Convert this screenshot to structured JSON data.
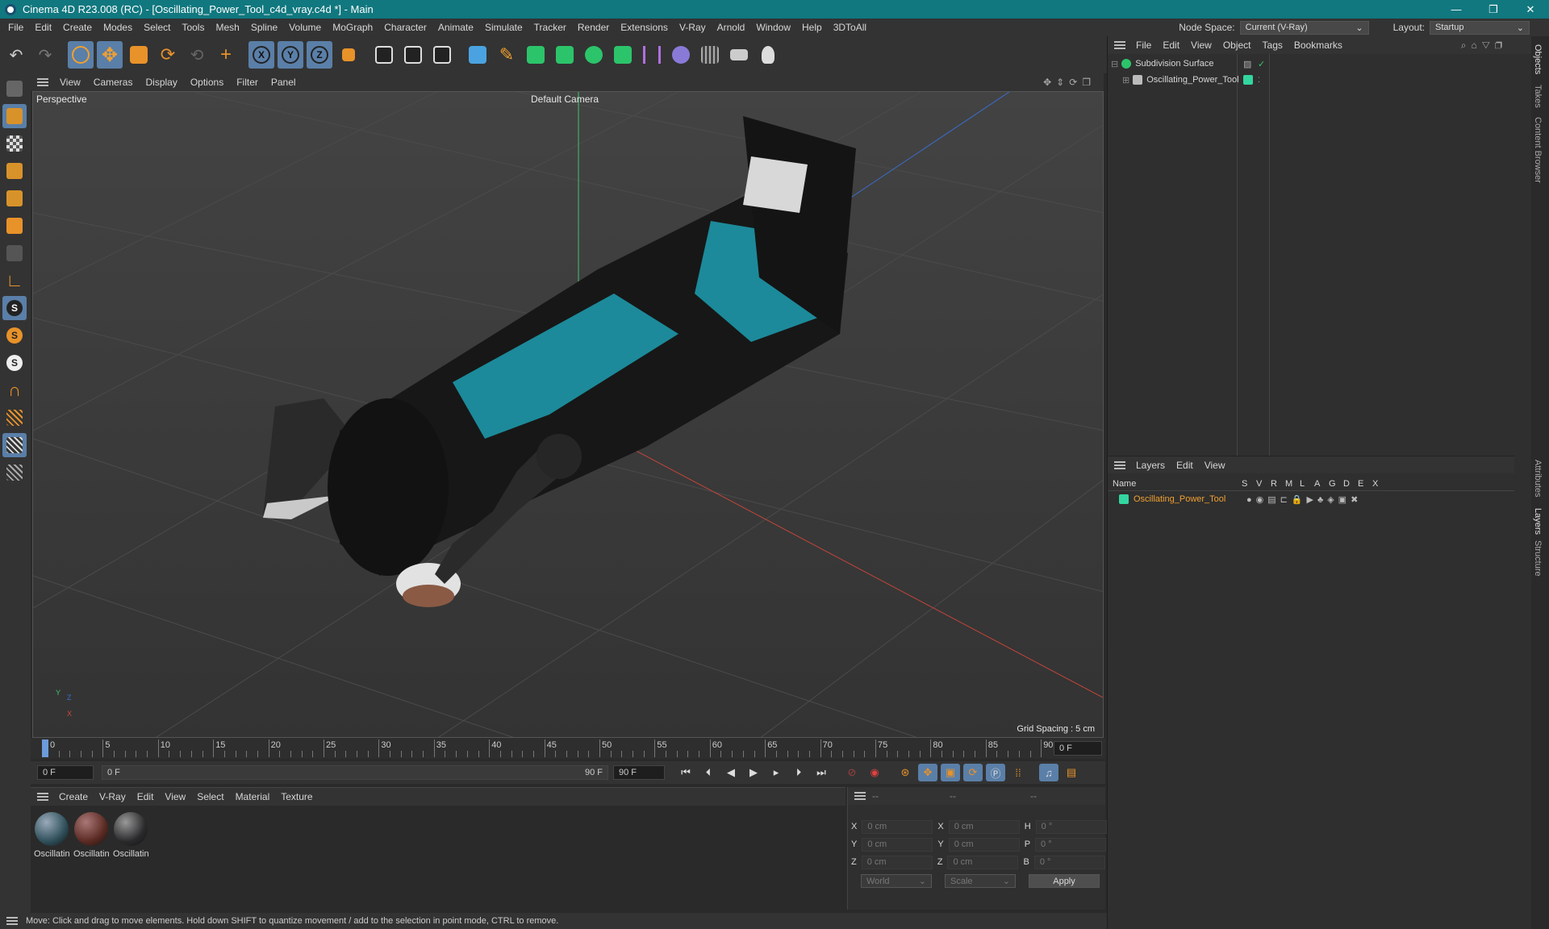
{
  "window": {
    "title": "Cinema 4D R23.008 (RC) - [Oscillating_Power_Tool_c4d_vray.c4d *] - Main",
    "buttons": [
      "—",
      "❐",
      "✕"
    ]
  },
  "menubar": {
    "items": [
      "File",
      "Edit",
      "Create",
      "Modes",
      "Select",
      "Tools",
      "Mesh",
      "Spline",
      "Volume",
      "MoGraph",
      "Character",
      "Animate",
      "Simulate",
      "Tracker",
      "Render",
      "Extensions",
      "V-Ray",
      "Arnold",
      "Window",
      "Help",
      "3DToAll"
    ],
    "node_space_label": "Node Space:",
    "node_space_value": "Current (V-Ray)",
    "layout_label": "Layout:",
    "layout_value": "Startup"
  },
  "viewport": {
    "menu": [
      "View",
      "Cameras",
      "Display",
      "Options",
      "Filter",
      "Panel"
    ],
    "view_name": "Perspective",
    "camera": "Default Camera",
    "grid_spacing": "Grid Spacing : 5 cm",
    "axis_labels": {
      "y": "Y",
      "z": "Z",
      "x": "X"
    }
  },
  "timeline": {
    "ticks": [
      "0",
      "5",
      "10",
      "15",
      "20",
      "25",
      "30",
      "35",
      "40",
      "45",
      "50",
      "55",
      "60",
      "65",
      "70",
      "75",
      "80",
      "85",
      "90"
    ],
    "current_frame": "0 F"
  },
  "playbar": {
    "start": "0 F",
    "range_start": "0 F",
    "range_end": "90 F",
    "end": "90 F"
  },
  "materials": {
    "menu": [
      "Create",
      "V-Ray",
      "Edit",
      "View",
      "Select",
      "Material",
      "Texture"
    ],
    "items": [
      {
        "label": "Oscillatin",
        "color": "#2f4f5a"
      },
      {
        "label": "Oscillatin",
        "color": "#5a2a22"
      },
      {
        "label": "Oscillatin",
        "color": "#2a2a2c"
      }
    ]
  },
  "coordinates": {
    "headers": [
      "--",
      "--",
      "--"
    ],
    "rows": [
      {
        "a": "X",
        "av": "0 cm",
        "b": "X",
        "bv": "0 cm",
        "c": "H",
        "cv": "0 °"
      },
      {
        "a": "Y",
        "av": "0 cm",
        "b": "Y",
        "bv": "0 cm",
        "c": "P",
        "cv": "0 °"
      },
      {
        "a": "Z",
        "av": "0 cm",
        "b": "Z",
        "bv": "0 cm",
        "c": "B",
        "cv": "0 °"
      }
    ],
    "mode1": "World",
    "mode2": "Scale",
    "apply": "Apply"
  },
  "objects": {
    "menu": [
      "File",
      "Edit",
      "View",
      "Object",
      "Tags",
      "Bookmarks"
    ],
    "items": [
      {
        "name": "Subdivision Surface",
        "color": "#888888"
      },
      {
        "name": "Oscillating_Power_Tool",
        "color": "#33d6a0"
      }
    ]
  },
  "layers": {
    "menu": [
      "Layers",
      "Edit",
      "View"
    ],
    "columns": [
      "Name",
      "S",
      "V",
      "R",
      "M",
      "L",
      "A",
      "G",
      "D",
      "E",
      "X"
    ],
    "items": [
      {
        "name": "Oscillating_Power_Tool",
        "color": "#33d6a0"
      }
    ]
  },
  "side_tabs": [
    "Objects",
    "Takes",
    "Content Browser",
    "Attributes",
    "Layers",
    "Structure"
  ],
  "status": "Move: Click and drag to move elements. Hold down SHIFT to quantize movement / add to the selection in point mode, CTRL to remove."
}
